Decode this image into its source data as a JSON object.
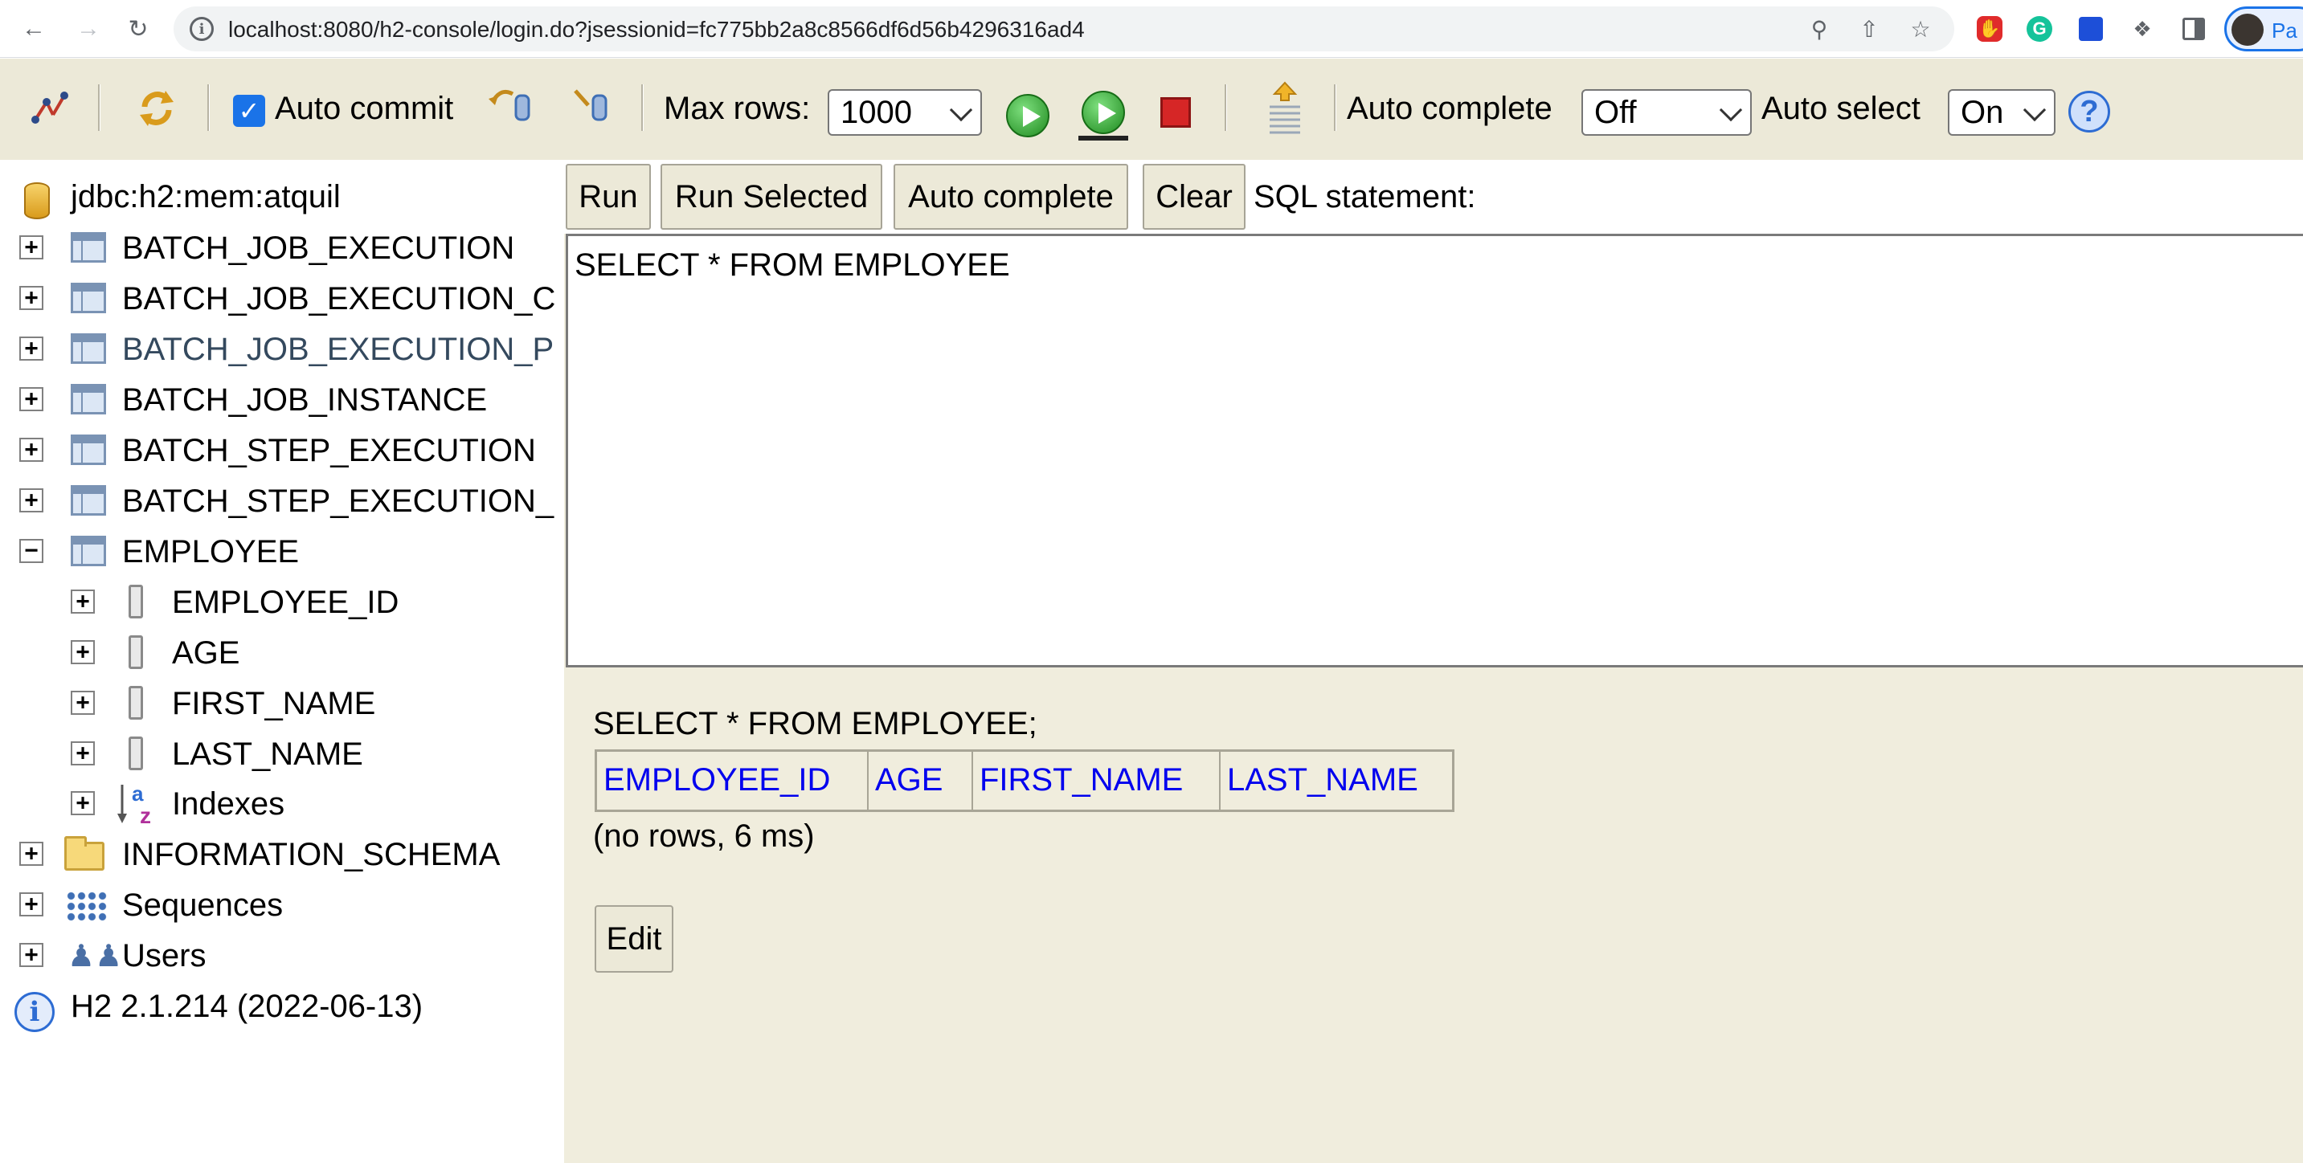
{
  "browser": {
    "url": "localhost:8080/h2-console/login.do?jsessionid=fc775bb2a8c8566df6d56b4296316ad4",
    "profile_name": "Pa"
  },
  "toolbar": {
    "auto_commit_label": "Auto commit",
    "auto_commit_checked": true,
    "max_rows_label": "Max rows:",
    "max_rows_value": "1000",
    "auto_complete_label": "Auto complete",
    "auto_complete_value": "Off",
    "auto_select_label": "Auto select",
    "auto_select_value": "On",
    "help_glyph": "?"
  },
  "tree": {
    "connection": "jdbc:h2:mem:atquil",
    "tables": [
      "BATCH_JOB_EXECUTION",
      "BATCH_JOB_EXECUTION_C",
      "BATCH_JOB_EXECUTION_P",
      "BATCH_JOB_INSTANCE",
      "BATCH_STEP_EXECUTION",
      "BATCH_STEP_EXECUTION_",
      "EMPLOYEE"
    ],
    "employee_columns": [
      "EMPLOYEE_ID",
      "AGE",
      "FIRST_NAME",
      "LAST_NAME"
    ],
    "indexes_label": "Indexes",
    "information_schema": "INFORMATION_SCHEMA",
    "sequences": "Sequences",
    "users": "Users",
    "version": "H2 2.1.214 (2022-06-13)"
  },
  "query": {
    "run_label": "Run",
    "run_selected_label": "Run Selected",
    "auto_complete_label": "Auto complete",
    "clear_label": "Clear",
    "sql_statement_label": "SQL statement:",
    "sql_text": "SELECT * FROM EMPLOYEE"
  },
  "result": {
    "executed_sql": "SELECT * FROM EMPLOYEE;",
    "columns": [
      "EMPLOYEE_ID",
      "AGE",
      "FIRST_NAME",
      "LAST_NAME"
    ],
    "status": "(no rows, 6 ms)",
    "edit_label": "Edit"
  },
  "colors": {
    "panel_bg": "#f0eddd",
    "toolbar_bg": "#ece9d8",
    "link_blue": "#0000ee",
    "highlight_row_text": "#34495e"
  }
}
